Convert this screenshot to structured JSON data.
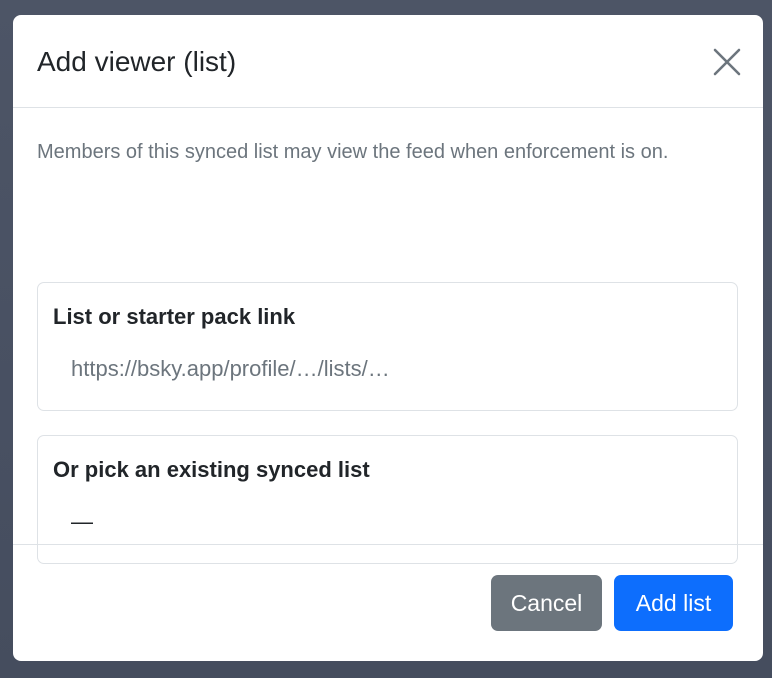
{
  "dialog": {
    "title": "Add viewer (list)",
    "close_icon": "close-icon"
  },
  "body": {
    "help_text": "Members of this synced list may view the feed when enforcement is on.",
    "link_field": {
      "label": "List or starter pack link",
      "placeholder": "https://bsky.app/profile/…/lists/…",
      "value": ""
    },
    "pick_field": {
      "label": "Or pick an existing synced list",
      "selected": "—"
    }
  },
  "footer": {
    "cancel_label": "Cancel",
    "add_label": "Add list"
  },
  "colors": {
    "primary": "#0d6efd",
    "secondary": "#6c757d",
    "border": "#dee2e6",
    "text": "#212529",
    "muted": "#6c757d"
  }
}
